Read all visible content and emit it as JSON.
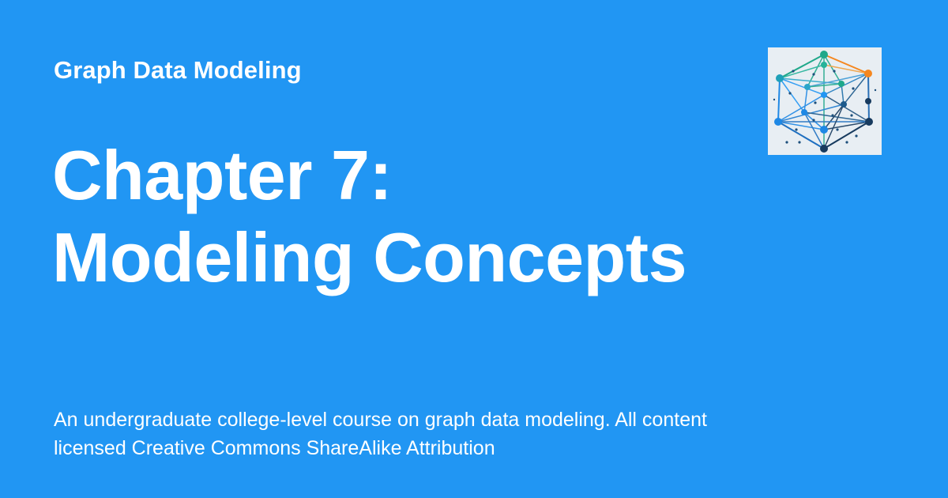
{
  "site": {
    "name": "Graph Data Modeling"
  },
  "title": {
    "line1": "Chapter 7:",
    "line2": "Modeling Concepts"
  },
  "description": "An undergraduate college-level course on graph data modeling. All content licensed Creative Commons ShareAlike Attribution",
  "logo": {
    "icon": "graph-network-icon"
  },
  "colors": {
    "background": "#2196f3",
    "text": "#ffffff",
    "logo_background": "#e8eef3",
    "accent_teal": "#1fa88a",
    "accent_orange": "#f5871f",
    "accent_blue": "#1e88e5",
    "accent_navy": "#173a5e"
  }
}
